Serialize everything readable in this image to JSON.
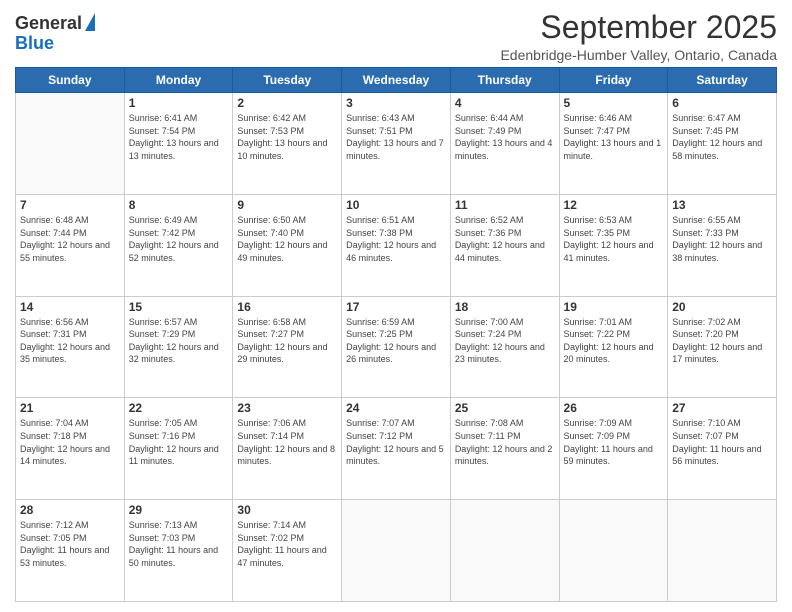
{
  "header": {
    "logo_general": "General",
    "logo_blue": "Blue",
    "title": "September 2025",
    "subtitle": "Edenbridge-Humber Valley, Ontario, Canada"
  },
  "days_of_week": [
    "Sunday",
    "Monday",
    "Tuesday",
    "Wednesday",
    "Thursday",
    "Friday",
    "Saturday"
  ],
  "weeks": [
    [
      {
        "day": "",
        "sunrise": "",
        "sunset": "",
        "daylight": ""
      },
      {
        "day": "1",
        "sunrise": "Sunrise: 6:41 AM",
        "sunset": "Sunset: 7:54 PM",
        "daylight": "Daylight: 13 hours and 13 minutes."
      },
      {
        "day": "2",
        "sunrise": "Sunrise: 6:42 AM",
        "sunset": "Sunset: 7:53 PM",
        "daylight": "Daylight: 13 hours and 10 minutes."
      },
      {
        "day": "3",
        "sunrise": "Sunrise: 6:43 AM",
        "sunset": "Sunset: 7:51 PM",
        "daylight": "Daylight: 13 hours and 7 minutes."
      },
      {
        "day": "4",
        "sunrise": "Sunrise: 6:44 AM",
        "sunset": "Sunset: 7:49 PM",
        "daylight": "Daylight: 13 hours and 4 minutes."
      },
      {
        "day": "5",
        "sunrise": "Sunrise: 6:46 AM",
        "sunset": "Sunset: 7:47 PM",
        "daylight": "Daylight: 13 hours and 1 minute."
      },
      {
        "day": "6",
        "sunrise": "Sunrise: 6:47 AM",
        "sunset": "Sunset: 7:45 PM",
        "daylight": "Daylight: 12 hours and 58 minutes."
      }
    ],
    [
      {
        "day": "7",
        "sunrise": "Sunrise: 6:48 AM",
        "sunset": "Sunset: 7:44 PM",
        "daylight": "Daylight: 12 hours and 55 minutes."
      },
      {
        "day": "8",
        "sunrise": "Sunrise: 6:49 AM",
        "sunset": "Sunset: 7:42 PM",
        "daylight": "Daylight: 12 hours and 52 minutes."
      },
      {
        "day": "9",
        "sunrise": "Sunrise: 6:50 AM",
        "sunset": "Sunset: 7:40 PM",
        "daylight": "Daylight: 12 hours and 49 minutes."
      },
      {
        "day": "10",
        "sunrise": "Sunrise: 6:51 AM",
        "sunset": "Sunset: 7:38 PM",
        "daylight": "Daylight: 12 hours and 46 minutes."
      },
      {
        "day": "11",
        "sunrise": "Sunrise: 6:52 AM",
        "sunset": "Sunset: 7:36 PM",
        "daylight": "Daylight: 12 hours and 44 minutes."
      },
      {
        "day": "12",
        "sunrise": "Sunrise: 6:53 AM",
        "sunset": "Sunset: 7:35 PM",
        "daylight": "Daylight: 12 hours and 41 minutes."
      },
      {
        "day": "13",
        "sunrise": "Sunrise: 6:55 AM",
        "sunset": "Sunset: 7:33 PM",
        "daylight": "Daylight: 12 hours and 38 minutes."
      }
    ],
    [
      {
        "day": "14",
        "sunrise": "Sunrise: 6:56 AM",
        "sunset": "Sunset: 7:31 PM",
        "daylight": "Daylight: 12 hours and 35 minutes."
      },
      {
        "day": "15",
        "sunrise": "Sunrise: 6:57 AM",
        "sunset": "Sunset: 7:29 PM",
        "daylight": "Daylight: 12 hours and 32 minutes."
      },
      {
        "day": "16",
        "sunrise": "Sunrise: 6:58 AM",
        "sunset": "Sunset: 7:27 PM",
        "daylight": "Daylight: 12 hours and 29 minutes."
      },
      {
        "day": "17",
        "sunrise": "Sunrise: 6:59 AM",
        "sunset": "Sunset: 7:25 PM",
        "daylight": "Daylight: 12 hours and 26 minutes."
      },
      {
        "day": "18",
        "sunrise": "Sunrise: 7:00 AM",
        "sunset": "Sunset: 7:24 PM",
        "daylight": "Daylight: 12 hours and 23 minutes."
      },
      {
        "day": "19",
        "sunrise": "Sunrise: 7:01 AM",
        "sunset": "Sunset: 7:22 PM",
        "daylight": "Daylight: 12 hours and 20 minutes."
      },
      {
        "day": "20",
        "sunrise": "Sunrise: 7:02 AM",
        "sunset": "Sunset: 7:20 PM",
        "daylight": "Daylight: 12 hours and 17 minutes."
      }
    ],
    [
      {
        "day": "21",
        "sunrise": "Sunrise: 7:04 AM",
        "sunset": "Sunset: 7:18 PM",
        "daylight": "Daylight: 12 hours and 14 minutes."
      },
      {
        "day": "22",
        "sunrise": "Sunrise: 7:05 AM",
        "sunset": "Sunset: 7:16 PM",
        "daylight": "Daylight: 12 hours and 11 minutes."
      },
      {
        "day": "23",
        "sunrise": "Sunrise: 7:06 AM",
        "sunset": "Sunset: 7:14 PM",
        "daylight": "Daylight: 12 hours and 8 minutes."
      },
      {
        "day": "24",
        "sunrise": "Sunrise: 7:07 AM",
        "sunset": "Sunset: 7:12 PM",
        "daylight": "Daylight: 12 hours and 5 minutes."
      },
      {
        "day": "25",
        "sunrise": "Sunrise: 7:08 AM",
        "sunset": "Sunset: 7:11 PM",
        "daylight": "Daylight: 12 hours and 2 minutes."
      },
      {
        "day": "26",
        "sunrise": "Sunrise: 7:09 AM",
        "sunset": "Sunset: 7:09 PM",
        "daylight": "Daylight: 11 hours and 59 minutes."
      },
      {
        "day": "27",
        "sunrise": "Sunrise: 7:10 AM",
        "sunset": "Sunset: 7:07 PM",
        "daylight": "Daylight: 11 hours and 56 minutes."
      }
    ],
    [
      {
        "day": "28",
        "sunrise": "Sunrise: 7:12 AM",
        "sunset": "Sunset: 7:05 PM",
        "daylight": "Daylight: 11 hours and 53 minutes."
      },
      {
        "day": "29",
        "sunrise": "Sunrise: 7:13 AM",
        "sunset": "Sunset: 7:03 PM",
        "daylight": "Daylight: 11 hours and 50 minutes."
      },
      {
        "day": "30",
        "sunrise": "Sunrise: 7:14 AM",
        "sunset": "Sunset: 7:02 PM",
        "daylight": "Daylight: 11 hours and 47 minutes."
      },
      {
        "day": "",
        "sunrise": "",
        "sunset": "",
        "daylight": ""
      },
      {
        "day": "",
        "sunrise": "",
        "sunset": "",
        "daylight": ""
      },
      {
        "day": "",
        "sunrise": "",
        "sunset": "",
        "daylight": ""
      },
      {
        "day": "",
        "sunrise": "",
        "sunset": "",
        "daylight": ""
      }
    ]
  ]
}
